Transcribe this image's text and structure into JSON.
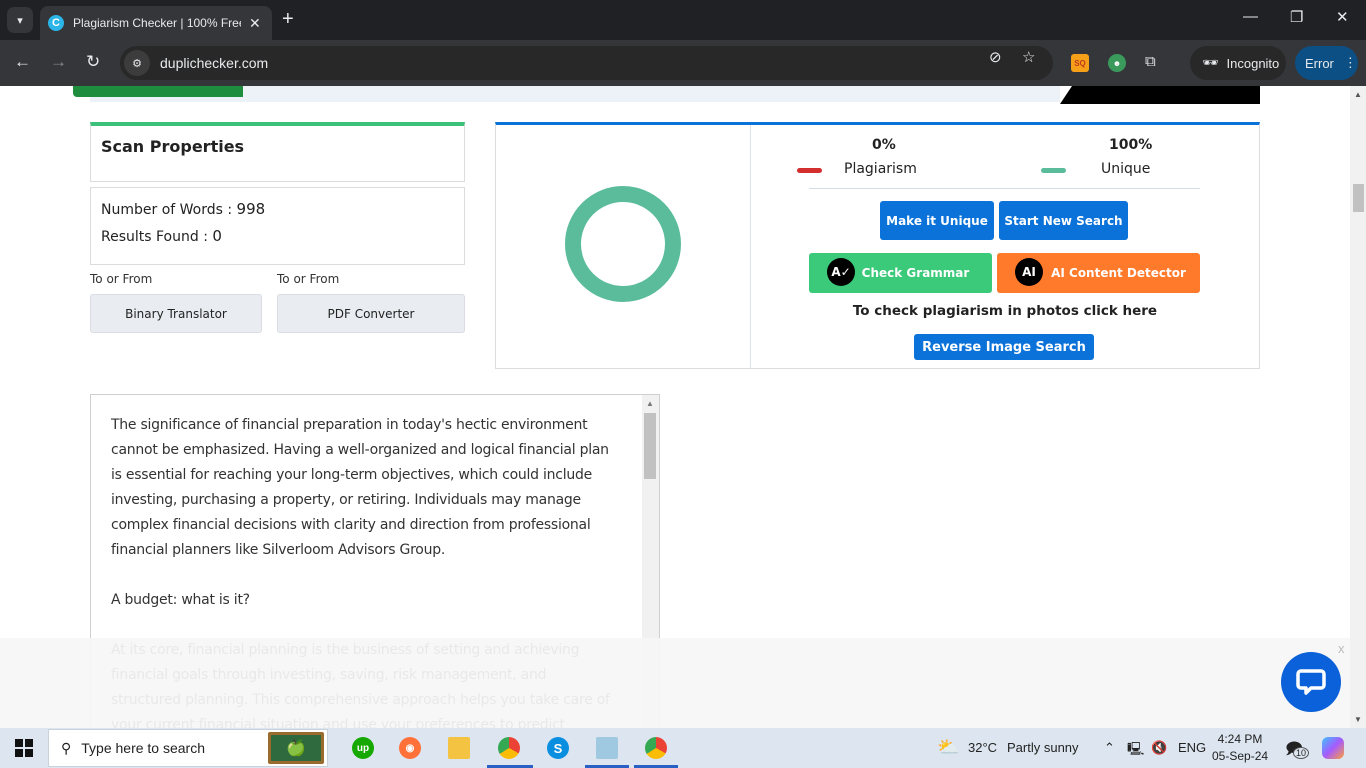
{
  "browser": {
    "tab_title": "Plagiarism Checker | 100% Free",
    "url": "duplichecker.com",
    "incognito_label": "Incognito",
    "error_label": "Error"
  },
  "scan_properties": {
    "title": "Scan Properties",
    "words_label": "Number of Words : ",
    "words_value": "998",
    "results_label": "Results Found : ",
    "results_value": "0"
  },
  "tools": [
    {
      "caption": "To or From",
      "label": "Binary Translator"
    },
    {
      "caption": "To or From",
      "label": "PDF Converter"
    }
  ],
  "results": {
    "plagiarism_pct": "0%",
    "plagiarism_label": "Plagiarism",
    "unique_pct": "100%",
    "unique_label": "Unique",
    "plagiarism_fraction": 0,
    "unique_fraction": 1,
    "colors": {
      "plagiarism": "#d32f2f",
      "unique": "#5bbc9b",
      "primary": "#0a72d8",
      "grammar": "#3bc97a",
      "ai": "#ff7a2b"
    },
    "buttons": {
      "make_unique": "Make it Unique",
      "new_search": "Start New Search",
      "check_grammar": "Check Grammar",
      "ai_detector": "AI Content Detector",
      "reverse_image": "Reverse Image Search"
    },
    "photo_text": "To check plagiarism in photos click here"
  },
  "text": {
    "paragraphs": [
      "The significance of financial preparation in today's hectic environment cannot be emphasized. Having a well-organized and logical financial plan is essential for reaching your long-term objectives, which could include investing, purchasing a property, or retiring. Individuals may manage complex financial decisions with clarity and direction from professional financial planners like Silverloom Advisors Group.",
      "A budget: what is it?",
      "At its core, financial planning is the business of setting and achieving financial goals through investing, saving, risk management, and structured planning. This comprehensive approach helps you take care of your current financial situation and use your preferences to predict"
    ]
  },
  "overlay": {
    "close_label": "x"
  },
  "taskbar": {
    "search_placeholder": "Type here to search",
    "weather_temp": "32°C",
    "weather_desc": "Partly sunny",
    "language": "ENG",
    "time": "4:24 PM",
    "date": "05-Sep-24",
    "notifications": "10"
  }
}
